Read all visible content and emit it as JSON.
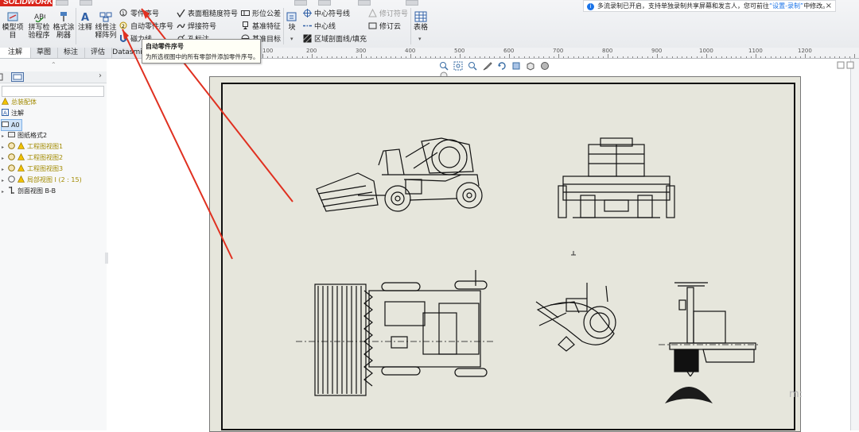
{
  "app": {
    "logo": "SOLIDWORKS"
  },
  "ribbon": {
    "big_buttons": [
      {
        "label1": "模型项",
        "label2": "目"
      },
      {
        "label1": "拼写检",
        "label2": "验程序"
      },
      {
        "label1": "格式涂",
        "label2": "刷器"
      },
      {
        "label1": "注释",
        "label2": ""
      },
      {
        "label1": "线性注",
        "label2": "释阵列"
      }
    ],
    "col1": {
      "balloon": "零件序号",
      "auto_balloon": "自动零件序号",
      "magnetic_line": "磁力线"
    },
    "col2": {
      "surface_finish": "表面粗糙度符号",
      "weld_symbol": "焊接符号",
      "hole_callout": "孔标注"
    },
    "col3": {
      "geometric_tolerance": "形位公差",
      "datum_feature": "基准特征",
      "datum_target": "基准目标"
    },
    "col4": {
      "block": "块",
      "center_mark": "中心符号线",
      "centerline": "中心线",
      "area_hatch": "区域剖面线/填充"
    },
    "col5": {
      "revision_symbol": "修订符号",
      "revision_cloud": "修订云"
    },
    "col6": {
      "tables": "表格"
    }
  },
  "tabs": [
    {
      "label": "注解",
      "active": true
    },
    {
      "label": "草图",
      "active": false
    },
    {
      "label": "标注",
      "active": false
    },
    {
      "label": "评估",
      "active": false
    },
    {
      "label": "Datasmi",
      "active": false
    }
  ],
  "tooltip": {
    "title": "自动零件序号",
    "description": "为所选视图中的所有零部件添加零件序号。"
  },
  "notice": {
    "text_pre": "多流录制已开启，支持单独录制共享屏幕和发言人，您可前往",
    "link": "“设置-录制”",
    "text_post": "中修改。",
    "close": "×"
  },
  "ruler": {
    "labels": [
      "100",
      "200",
      "300",
      "400",
      "500",
      "600",
      "700",
      "800",
      "900",
      "1000",
      "1100",
      "1200"
    ]
  },
  "tree": {
    "items": [
      {
        "label": "总装配体",
        "warn": true
      },
      {
        "label": "注解",
        "warn": false
      },
      {
        "label": "A0",
        "warn": false,
        "selected": true
      },
      {
        "label": "图纸格式2",
        "warn": false
      },
      {
        "label": "工程图视图1",
        "warn": true
      },
      {
        "label": "工程图视图2",
        "warn": true
      },
      {
        "label": "工程图视图3",
        "warn": true
      },
      {
        "label": "局部视图 I (2 : 15)",
        "warn": true
      },
      {
        "label": "剖面视图 B-B",
        "warn": false
      }
    ]
  },
  "colors": {
    "accent": "#1a73e8",
    "sheet": "#e6e6dc",
    "annotation_red": "#e03020",
    "brand": "#d9261c"
  }
}
